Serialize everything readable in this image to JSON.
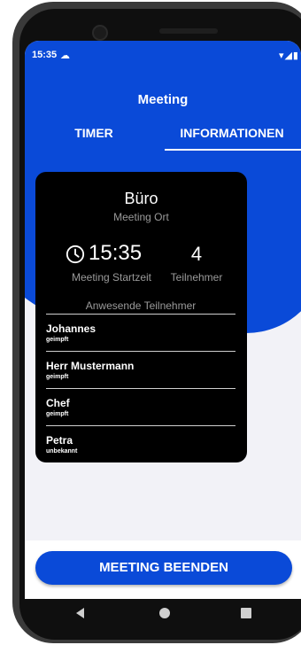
{
  "status_bar": {
    "time": "15:35",
    "notification_icon": "cloud-icon",
    "right_icons": "▾◢▮"
  },
  "app": {
    "title": "Meeting"
  },
  "tabs": [
    {
      "label": "TIMER"
    },
    {
      "label": "INFORMATIONEN",
      "selected": true
    }
  ],
  "card": {
    "place": "Büro",
    "place_label": "Meeting Ort",
    "start_time": "15:35",
    "start_time_label": "Meeting Startzeit",
    "participant_count": "4",
    "participant_count_label": "Teilnehmer",
    "attendees_title": "Anwesende Teilnehmer",
    "attendees": [
      {
        "name": "Johannes",
        "status": "geimpft"
      },
      {
        "name": "Herr Mustermann",
        "status": "geimpft"
      },
      {
        "name": "Chef",
        "status": "geimpft"
      },
      {
        "name": "Petra",
        "status": "unbekannt"
      }
    ]
  },
  "footer": {
    "end_button_label": "MEETING BEENDEN"
  },
  "colors": {
    "primary": "#0a4ad8",
    "card_background": "#000000",
    "screen_background": "#f2f2f7"
  },
  "navigation_bar": {
    "icons": [
      "back-icon",
      "home-icon",
      "recent-apps-icon"
    ]
  }
}
